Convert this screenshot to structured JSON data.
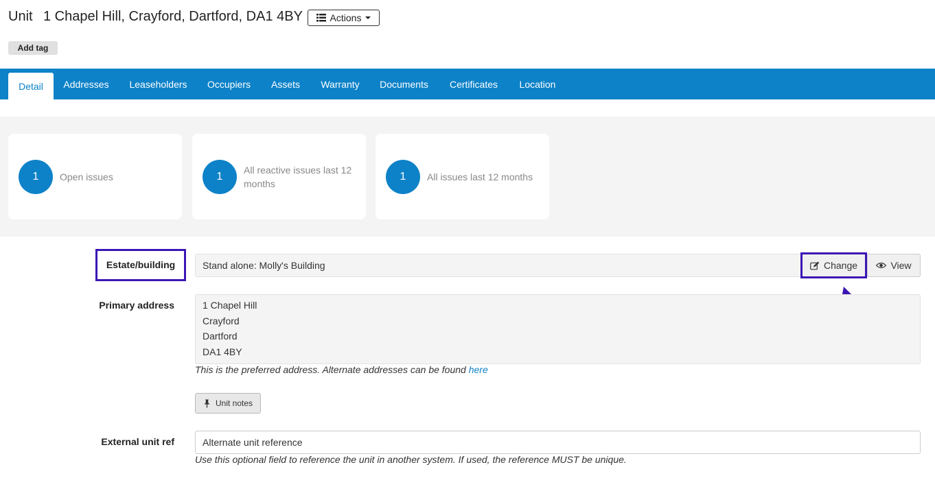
{
  "header": {
    "prefix": "Unit",
    "address": "1 Chapel Hill, Crayford, Dartford, DA1 4BY",
    "actions_label": "Actions",
    "add_tag_label": "Add tag"
  },
  "tabs": [
    {
      "label": "Detail",
      "active": true
    },
    {
      "label": "Addresses"
    },
    {
      "label": "Leaseholders"
    },
    {
      "label": "Occupiers"
    },
    {
      "label": "Assets"
    },
    {
      "label": "Warranty"
    },
    {
      "label": "Documents"
    },
    {
      "label": "Certificates"
    },
    {
      "label": "Location"
    }
  ],
  "stats": [
    {
      "count": "1",
      "label": "Open issues"
    },
    {
      "count": "1",
      "label": "All reactive issues last 12 months"
    },
    {
      "count": "1",
      "label": "All issues last 12 months"
    }
  ],
  "estate": {
    "label": "Estate/building",
    "value": "Stand alone: Molly's Building",
    "change_label": "Change",
    "view_label": "View"
  },
  "primary_address": {
    "label": "Primary address",
    "lines": [
      "1 Chapel Hill",
      "Crayford",
      "Dartford",
      "DA1 4BY"
    ],
    "help_text": "This is the preferred address. Alternate addresses can be found",
    "help_link": "here"
  },
  "unit_notes_label": "Unit notes",
  "external_ref": {
    "label": "External unit ref",
    "placeholder": "Alternate unit reference",
    "help_text": "Use this optional field to reference the unit in another system. If used, the reference MUST be unique."
  },
  "colors": {
    "brand_blue": "#0d82c8",
    "annotation_purple": "#3c16b5"
  },
  "icons": {
    "actions": "list-icon",
    "change": "edit-icon",
    "view": "eye-icon",
    "unit_notes": "pin-icon"
  }
}
